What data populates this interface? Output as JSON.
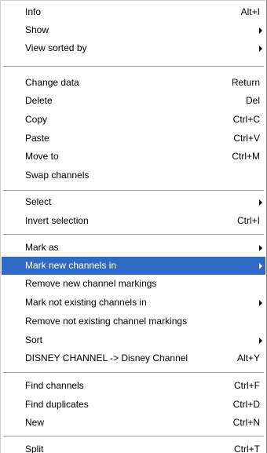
{
  "context_menu": {
    "highlight_color": "#316ac5",
    "items": [
      {
        "label": "Info",
        "shortcut": "Alt+I"
      },
      {
        "label": "Show",
        "submenu_icon": "chevron-right-icon"
      },
      {
        "label": "View sorted by",
        "submenu_icon": "chevron-right-icon"
      },
      {
        "label": "Change data",
        "shortcut": "Return"
      },
      {
        "label": "Delete",
        "shortcut": "Del"
      },
      {
        "label": "Copy",
        "shortcut": "Ctrl+C"
      },
      {
        "label": "Paste",
        "shortcut": "Ctrl+V"
      },
      {
        "label": "Move to",
        "shortcut": "Ctrl+M"
      },
      {
        "label": "Swap channels"
      },
      {
        "label": "Select",
        "submenu_icon": "chevron-right-icon"
      },
      {
        "label": "Invert selection",
        "shortcut": "Ctrl+I"
      },
      {
        "label": "Mark as",
        "submenu_icon": "chevron-right-icon"
      },
      {
        "label": "Mark new channels in",
        "submenu_icon": "chevron-right-icon",
        "highlighted": true
      },
      {
        "label": "Remove new channel markings"
      },
      {
        "label": "Mark not existing channels in",
        "submenu_icon": "chevron-right-icon"
      },
      {
        "label": "Remove not existing channel markings"
      },
      {
        "label": "Sort",
        "submenu_icon": "chevron-right-icon"
      },
      {
        "label": "DISNEY CHANNEL -> Disney Channel",
        "shortcut": "Alt+Y"
      },
      {
        "label": "Find channels",
        "shortcut": "Ctrl+F"
      },
      {
        "label": "Find duplicates",
        "shortcut": "Ctrl+D"
      },
      {
        "label": "New",
        "shortcut": "Ctrl+N"
      },
      {
        "label": "Split",
        "shortcut": "Ctrl+T"
      }
    ]
  }
}
